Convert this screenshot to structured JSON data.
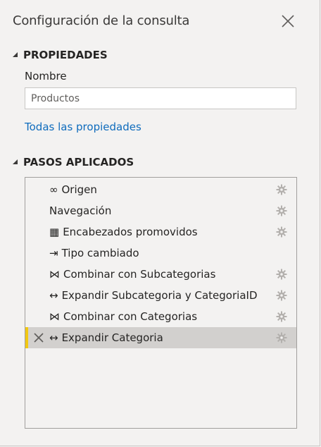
{
  "panel": {
    "title": "Configuración de la consulta"
  },
  "properties": {
    "header": "PROPIEDADES",
    "name_label": "Nombre",
    "name_value": "Productos",
    "all_props_link": "Todas las propiedades"
  },
  "applied_steps": {
    "header": "PASOS APLICADOS",
    "selected_index": 7,
    "steps": [
      {
        "icon": "∞",
        "icon_name": "source-icon",
        "name": "Origen",
        "has_settings": true
      },
      {
        "icon": "",
        "icon_name": "",
        "name": "Navegación",
        "has_settings": true
      },
      {
        "icon": "▦",
        "icon_name": "table-icon",
        "name": "Encabezados promovidos",
        "has_settings": true
      },
      {
        "icon": "⇥",
        "icon_name": "type-change-icon",
        "name": "Tipo cambiado",
        "has_settings": false
      },
      {
        "icon": "⋈",
        "icon_name": "merge-icon",
        "name": "Combinar con Subcategorias",
        "has_settings": true
      },
      {
        "icon": "↔",
        "icon_name": "expand-icon",
        "name": "Expandir Subcategoria y CategoriaID",
        "has_settings": true
      },
      {
        "icon": "⋈",
        "icon_name": "merge-icon",
        "name": "Combinar con Categorias",
        "has_settings": true
      },
      {
        "icon": "↔",
        "icon_name": "expand-icon",
        "name": "Expandir Categoria",
        "has_settings": true
      }
    ]
  },
  "colors": {
    "background": "#f3f2f1",
    "link": "#0f6cbd",
    "selected_row": "#d2d0ce",
    "selected_accent": "#f2c811"
  }
}
